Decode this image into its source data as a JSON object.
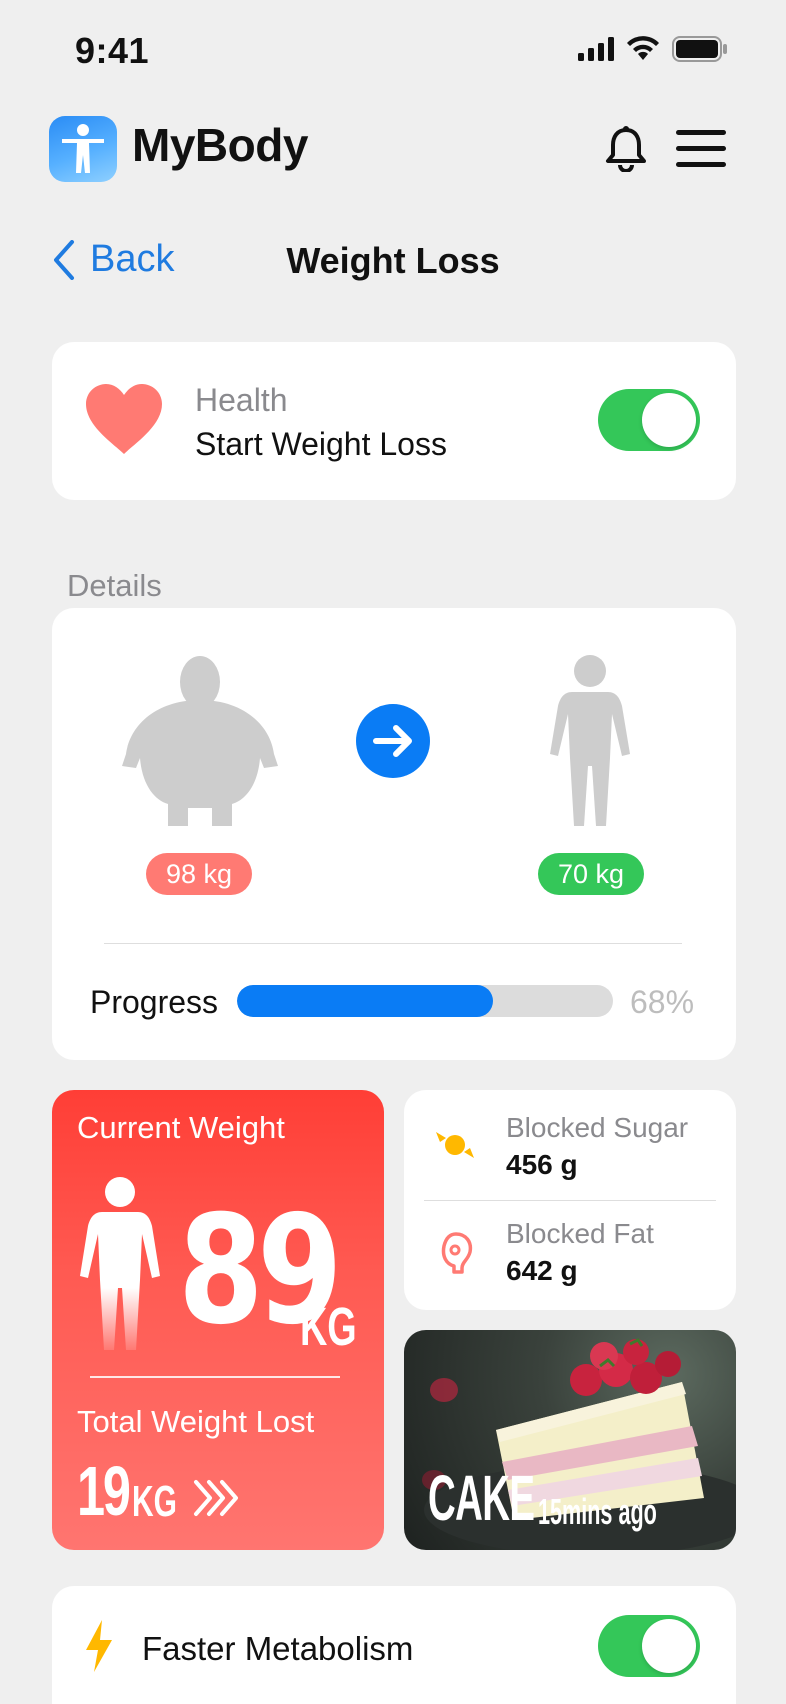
{
  "status_bar": {
    "time": "9:41"
  },
  "header": {
    "app_name": "MyBody"
  },
  "nav": {
    "back_label": "Back",
    "title": "Weight Loss"
  },
  "health": {
    "category": "Health",
    "label": "Start Weight Loss",
    "enabled": true
  },
  "details": {
    "section_label": "Details",
    "start_weight": "98 kg",
    "target_weight": "70 kg",
    "progress_label": "Progress",
    "progress_value": 0.68,
    "progress_text": "68%"
  },
  "current_weight": {
    "label": "Current Weight",
    "value": "89",
    "unit": "KG",
    "lost_label": "Total Weight Lost",
    "lost_value": "19",
    "lost_unit": "KG"
  },
  "blocked": {
    "sugar_label": "Blocked Sugar",
    "sugar_value": "456 g",
    "fat_label": "Blocked Fat",
    "fat_value": "642 g"
  },
  "food": {
    "title": "CAKE",
    "time": "15mins ago"
  },
  "metabolism": {
    "label": "Faster Metabolism",
    "enabled": true
  },
  "colors": {
    "accent_blue": "#0a7cf5",
    "toggle_green": "#34c759",
    "weight_red": "#ff3e36",
    "badge_red": "#ff7a73",
    "badge_green": "#34c759"
  },
  "icons": [
    "person-figure-icon",
    "bell-icon",
    "menu-icon",
    "chevron-left-icon",
    "heart-icon",
    "arrow-right-icon",
    "candy-icon",
    "meat-icon",
    "lightning-icon"
  ]
}
